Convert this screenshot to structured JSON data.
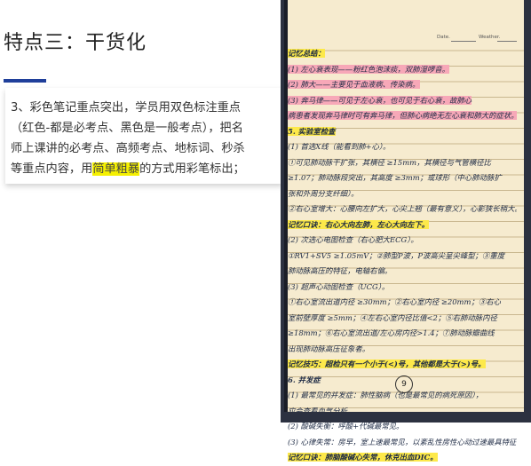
{
  "slide": {
    "title": "特点三：干货化",
    "desc_line1": "3、彩色笔记重点突出，学员用双色标注重点",
    "desc_line2": "（红色-都是必考点、黑色是一般考点），把名",
    "desc_line3": "师上课讲的必考点、高频考点、地标词、秒杀",
    "desc_line4a": "等重点内容，用",
    "desc_line4_hl": "简单粗暴",
    "desc_line4b": "的方式用彩笔标出；",
    "accent_color": "#1f3f9a",
    "highlight_color": "#f5f000"
  },
  "notebook": {
    "date_label": "Date.",
    "weather_label": "Weather.",
    "page_number": "9",
    "lines": [
      "记忆总结：",
      "(1) 左心衰表现——粉红色泡沫痰，双肺湿啰音。",
      "(2) 肺大——主要见于血液病、传染病。",
      "(3) 奔马律——可见于左心衰，也可见于右心衰，故肺心",
      "病患者发现奔马律时可有奔马律，但肺心病绝无左心衰和肺大的症状。",
      "5. 实验室检查",
      "(1) 首选X线（能看到肺+心）。",
      "①可见肺动脉干扩张，其横径 ≥15mm，其横径与气管横径比",
      "≥1.07；肺动脉段突出，其高度 ≥3mm；或球形（中心肺动脉扩",
      "张和外周分支纤细）。",
      "②右心室增大：心腰向左扩大，心尖上翘（最有意义），心影狭长稍大。",
      "记忆口诀：右心大向左肺，左心大向左下。",
      "(2) 次选心电图检查（右心肥大ECG）。",
      "①RV1+SV5 ≥1.05mV；②肺型P波，P波高尖呈尖峰型；③重度",
      "肺动脉高压的特征，电轴右偏。",
      "(3) 超声心动图检查（UCG）。",
      "①右心室流出道内径 ≥30mm；②右心室内径 ≥20mm；③右心",
      "室前壁厚度 ≥5mm；④左右心室内径比值<2；⑤右肺动脉内径",
      "≥18mm；⑥右心室流出道/左心房内径>1.4；⑦肺动脉瓣曲线",
      "出现肺动脉高压征象者。",
      "记忆技巧：超检只有一个小于(<)号，其他都是大于(>)号。",
      "6. 并发症",
      "(1) 最常见的并发症：肺性脑病（也是最常见的病死原因），",
      "应会查看血气分析。",
      "(2) 酸碱失衡：呼酸+代碱最常见。",
      "(3) 心律失常：房早，室上速最常见，以紊乱性房性心动过速最具特征性。",
      "记忆口诀：肺脑酸碱心失常，休克出血DIC。"
    ]
  }
}
